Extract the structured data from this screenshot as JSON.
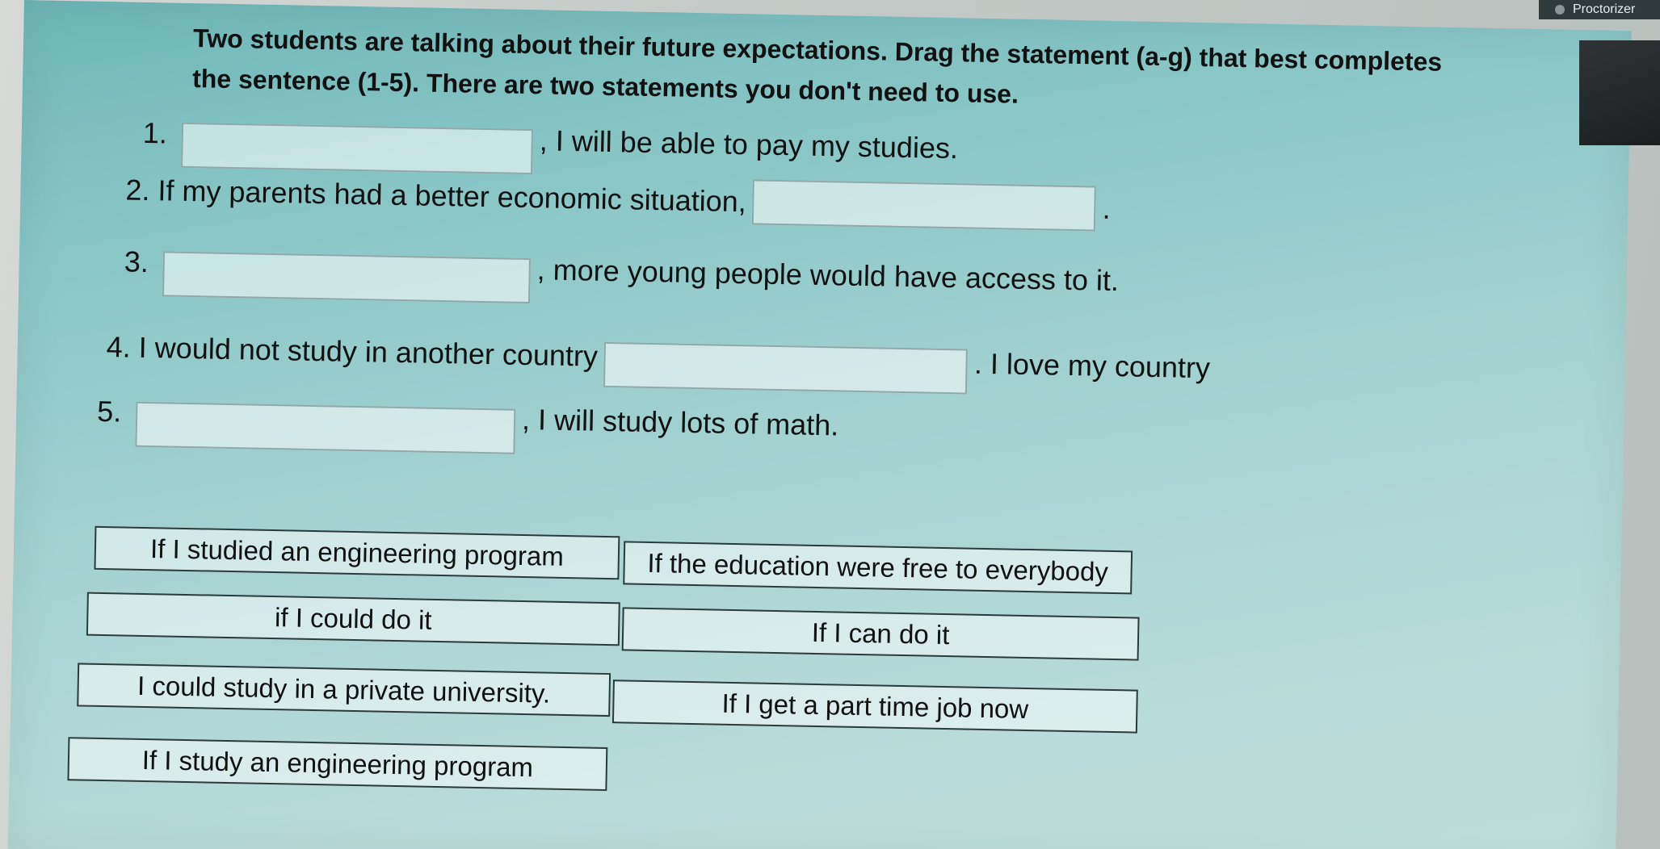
{
  "proctor": {
    "label": "Proctorizer"
  },
  "instructions": "Two students are talking about their future expectations. Drag the statement (a-g) that best completes the sentence (1-5). There are two statements you don't need to use.",
  "questions": [
    {
      "num": "1.",
      "before": "",
      "after": ", I will be able to pay my studies."
    },
    {
      "num": "2.",
      "before": "If my parents had a better economic situation,",
      "after": "."
    },
    {
      "num": "3.",
      "before": "",
      "after": ", more young people would have access to it."
    },
    {
      "num": "4.",
      "before": "I would not study in another country",
      "after": ". I love my country"
    },
    {
      "num": "5.",
      "before": "",
      "after": ", I will study lots of math."
    }
  ],
  "options": [
    "If I studied an engineering program",
    "If the education were free to everybody",
    "if I could do it",
    "If I can do it",
    "I could study in a private university.",
    "If I get a part time job now",
    "If I study an engineering program"
  ]
}
